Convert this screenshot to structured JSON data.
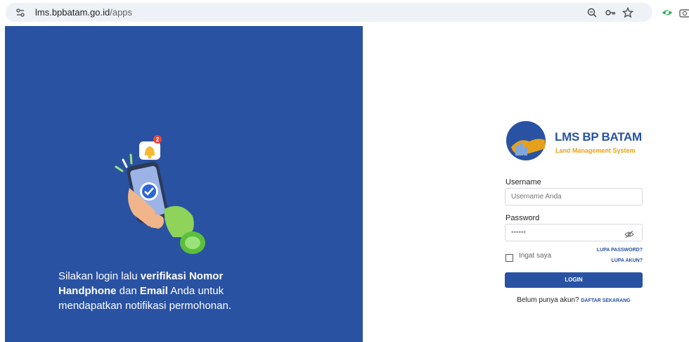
{
  "browser": {
    "url_domain": "lms.bpbatam.go.id",
    "url_path": "/apps"
  },
  "hero": {
    "text_1": "Silakan login lalu ",
    "text_bold_1": "verifikasi Nomor Handphone",
    "text_2": " dan ",
    "text_bold_2": "Email",
    "text_3": " Anda untuk mendapatkan notifikasi permohonan.",
    "badge_count": "2"
  },
  "brand": {
    "title": "LMS BP BATAM",
    "subtitle": "Land Management System"
  },
  "form": {
    "username_label": "Username",
    "username_placeholder": "Username Anda",
    "password_label": "Password",
    "password_value": "••••••",
    "remember_label": "Ingat saya",
    "forgot_password": "LUPA PASSWORD?",
    "forgot_account": "LUPA AKUN?",
    "login_button": "LOGIN",
    "signup_prompt": "Belum punya akun?",
    "signup_link": "DAFTAR SEKARANG"
  },
  "colors": {
    "primary": "#2952a3",
    "accent": "#e5a11c"
  }
}
